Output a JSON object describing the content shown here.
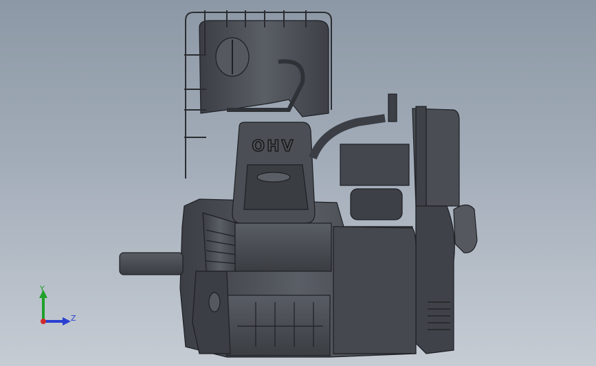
{
  "viewport": {
    "background_top": "#8d98a6",
    "background_bottom": "#c6ccd4"
  },
  "model": {
    "engine_label": "OHV",
    "body_color": "#4a4d53",
    "edge_color": "#1d1f23"
  },
  "triad": {
    "y_label": "Y",
    "z_label": "Z",
    "y_color": "#1fa12a",
    "z_color": "#2a3fd1",
    "x_color": "#d12a2a"
  }
}
